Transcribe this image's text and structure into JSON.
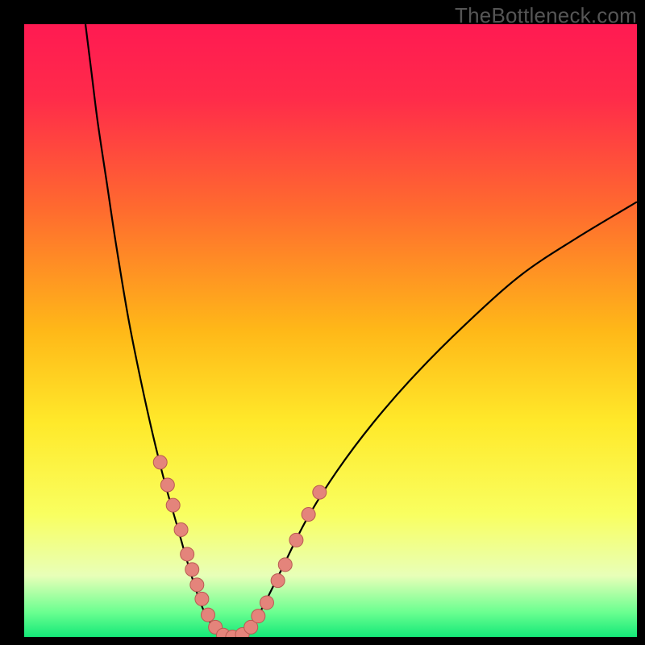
{
  "attribution": "TheBottleneck.com",
  "chart_data": {
    "type": "line",
    "title": "",
    "xlabel": "",
    "ylabel": "",
    "xlim": [
      0,
      100
    ],
    "ylim": [
      0,
      100
    ],
    "gradient_stops": [
      {
        "offset": 0.0,
        "color": "#ff1a52"
      },
      {
        "offset": 0.12,
        "color": "#ff2b4a"
      },
      {
        "offset": 0.3,
        "color": "#ff6a2f"
      },
      {
        "offset": 0.5,
        "color": "#ffb818"
      },
      {
        "offset": 0.65,
        "color": "#ffe92a"
      },
      {
        "offset": 0.8,
        "color": "#f9ff60"
      },
      {
        "offset": 0.9,
        "color": "#e8ffb8"
      },
      {
        "offset": 0.96,
        "color": "#6aff90"
      },
      {
        "offset": 1.0,
        "color": "#14e878"
      }
    ],
    "series": [
      {
        "name": "bottleneck-curve",
        "color": "#000000",
        "points": [
          {
            "x": 10.0,
            "y": 100.0
          },
          {
            "x": 11.0,
            "y": 92.0
          },
          {
            "x": 12.0,
            "y": 84.0
          },
          {
            "x": 13.5,
            "y": 74.0
          },
          {
            "x": 15.0,
            "y": 64.0
          },
          {
            "x": 17.0,
            "y": 52.0
          },
          {
            "x": 19.0,
            "y": 42.0
          },
          {
            "x": 21.0,
            "y": 33.0
          },
          {
            "x": 23.0,
            "y": 25.0
          },
          {
            "x": 25.0,
            "y": 18.0
          },
          {
            "x": 27.0,
            "y": 11.0
          },
          {
            "x": 29.0,
            "y": 5.0
          },
          {
            "x": 31.0,
            "y": 1.5
          },
          {
            "x": 33.0,
            "y": 0.0
          },
          {
            "x": 35.0,
            "y": 0.0
          },
          {
            "x": 37.0,
            "y": 1.5
          },
          {
            "x": 39.0,
            "y": 5.0
          },
          {
            "x": 42.0,
            "y": 11.0
          },
          {
            "x": 46.0,
            "y": 19.0
          },
          {
            "x": 51.0,
            "y": 27.0
          },
          {
            "x": 57.0,
            "y": 35.0
          },
          {
            "x": 64.0,
            "y": 43.0
          },
          {
            "x": 72.0,
            "y": 51.0
          },
          {
            "x": 81.0,
            "y": 59.0
          },
          {
            "x": 90.0,
            "y": 65.0
          },
          {
            "x": 100.0,
            "y": 71.0
          }
        ]
      }
    ],
    "markers": {
      "name": "highlight-dots",
      "x": [
        22.2,
        23.4,
        24.3,
        25.6,
        26.6,
        27.4,
        28.2,
        29.0,
        30.0,
        31.2,
        32.5,
        34.0,
        35.6,
        37.0,
        38.2,
        39.6,
        41.4,
        42.6,
        44.4,
        46.4,
        48.2
      ],
      "y": [
        28.5,
        24.8,
        21.5,
        17.5,
        13.5,
        11.0,
        8.5,
        6.2,
        3.6,
        1.6,
        0.3,
        0.0,
        0.4,
        1.6,
        3.4,
        5.6,
        9.2,
        11.8,
        15.8,
        20.0,
        23.6
      ],
      "r": 8.5,
      "fill": "#e4847b",
      "stroke": "#b95a52"
    }
  }
}
